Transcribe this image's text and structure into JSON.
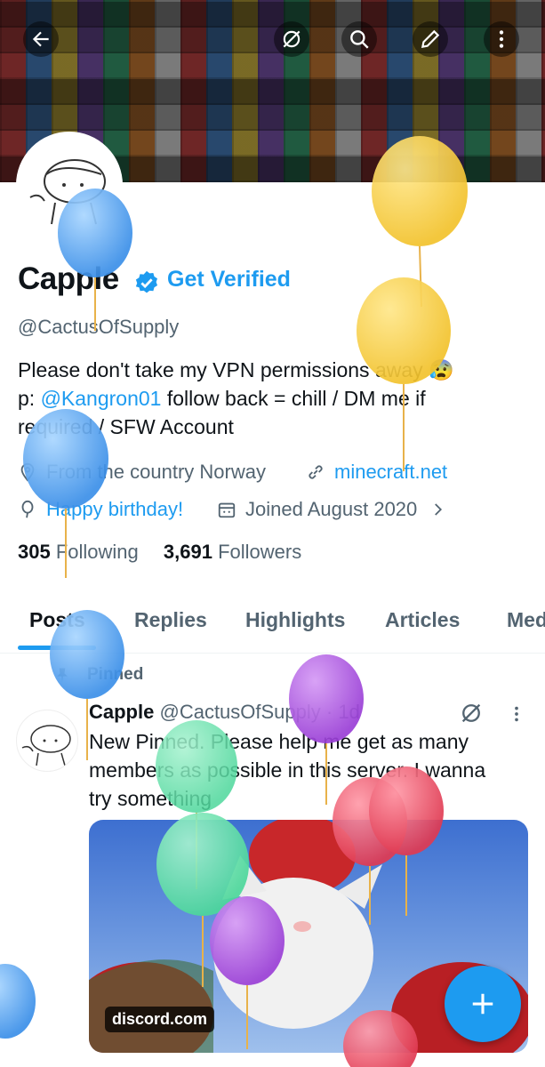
{
  "header": {
    "back_icon": "arrow-left-icon",
    "icons": [
      "grok-icon",
      "search-icon",
      "edit-icon",
      "more-vertical-icon"
    ]
  },
  "profile": {
    "name": "Capple",
    "get_verified": "Get Verified",
    "handle": "@CactusOfSupply",
    "bio_line1": "Please don't take my VPN permissions away 😰",
    "bio_line2_prefix": "p: ",
    "bio_mention": "@Kangron01",
    "bio_line2_suffix": " follow back = chill / DM me if",
    "bio_line3": "required / SFW Account",
    "location": "From the country Norway",
    "website": "minecraft.net",
    "birthday": "Happy birthday!",
    "joined": "Joined August 2020",
    "following_count": "305",
    "following_label": "Following",
    "followers_count": "3,691",
    "followers_label": "Followers"
  },
  "tabs": [
    "Posts",
    "Replies",
    "Highlights",
    "Articles",
    "Media"
  ],
  "pinned_post": {
    "pinned_label": "Pinned",
    "author": "Capple",
    "handle": "@CactusOfSupply",
    "time": "· 1d",
    "text_line1": "New Pinned. Please help me get as many",
    "text_line2": "members as possible in this server. I wanna",
    "text_line3": "try something",
    "media_source": "discord.com"
  },
  "fab": {
    "icon": "plus-icon"
  },
  "colors": {
    "accent": "#1d9bf0",
    "text": "#0f1419",
    "secondary": "#536471"
  }
}
